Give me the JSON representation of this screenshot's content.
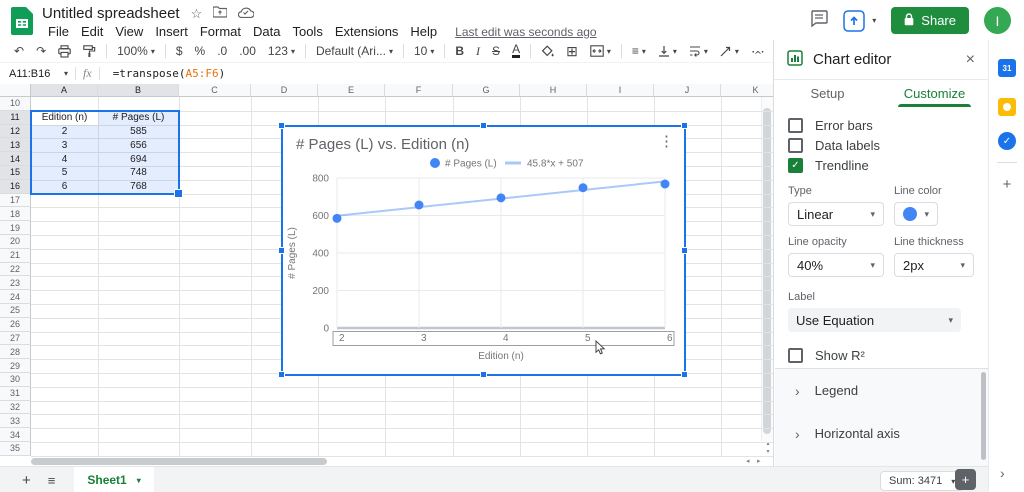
{
  "header": {
    "doc_title": "Untitled spreadsheet",
    "menu_items": [
      "File",
      "Edit",
      "View",
      "Insert",
      "Format",
      "Data",
      "Tools",
      "Extensions",
      "Help"
    ],
    "last_edit": "Last edit was seconds ago",
    "share_label": "Share",
    "avatar_letter": "I"
  },
  "toolbar": {
    "zoom_value": "100%",
    "currency": "$",
    "percent": "%",
    "decimal_decrease": ".0",
    "decimal_increase": ".00",
    "number_format": "123",
    "font_name": "Default (Ari...",
    "font_size": "10",
    "bold": "B",
    "italic": "I",
    "strikethrough": "S",
    "text_color": "A",
    "more": "⋯"
  },
  "formula_bar": {
    "name_box": "A11:B16",
    "fx_label": "fx",
    "formula_prefix": "=transpose(",
    "formula_range": "A5:F6",
    "formula_suffix": ")"
  },
  "grid": {
    "visible_columns": [
      "A",
      "B",
      "C",
      "D",
      "E",
      "F",
      "G",
      "H",
      "I",
      "J",
      "K"
    ],
    "first_visible_row": 10,
    "last_visible_row": 35,
    "selected_range": "A11:B16",
    "selected_columns": [
      "A",
      "B"
    ],
    "selected_rows": [
      11,
      12,
      13,
      14,
      15,
      16
    ],
    "table": {
      "origin_row": 11,
      "headers": [
        "Edition (n)",
        "# Pages (L)"
      ],
      "rows": [
        [
          "2",
          "585"
        ],
        [
          "3",
          "656"
        ],
        [
          "4",
          "694"
        ],
        [
          "5",
          "748"
        ],
        [
          "6",
          "768"
        ]
      ]
    }
  },
  "chart_data": {
    "type": "scatter",
    "title": "# Pages (L) vs. Edition (n)",
    "xlabel": "Edition (n)",
    "ylabel": "# Pages (L)",
    "x": [
      2,
      3,
      4,
      5,
      6
    ],
    "series": [
      {
        "name": "# Pages (L)",
        "values": [
          585,
          656,
          694,
          748,
          768
        ],
        "color": "#4285f4"
      }
    ],
    "trendline": {
      "label": "45.8*x + 507",
      "slope": 45.8,
      "intercept": 507,
      "color": "rgba(66,133,244,0.45)"
    },
    "x_ticks": [
      2,
      3,
      4,
      5,
      6
    ],
    "y_ticks": [
      0,
      200,
      400,
      600,
      800
    ],
    "xlim": [
      2,
      6
    ],
    "ylim": [
      0,
      800
    ],
    "grid": true,
    "legend_position": "top"
  },
  "chart_editor": {
    "title": "Chart editor",
    "tabs": [
      {
        "label": "Setup",
        "active": false
      },
      {
        "label": "Customize",
        "active": true
      }
    ],
    "checkboxes": [
      {
        "label": "Error bars",
        "checked": false
      },
      {
        "label": "Data labels",
        "checked": false
      },
      {
        "label": "Trendline",
        "checked": true
      }
    ],
    "type_label": "Type",
    "type_value": "Linear",
    "line_color_label": "Line color",
    "line_color_value": "#4285f4",
    "line_opacity_label": "Line opacity",
    "line_opacity_value": "40%",
    "line_thickness_label": "Line thickness",
    "line_thickness_value": "2px",
    "label_label": "Label",
    "label_value": "Use Equation",
    "show_r2": {
      "label": "Show R²",
      "checked": false
    },
    "sections": [
      "Legend",
      "Horizontal axis"
    ]
  },
  "bottom_bar": {
    "sheet_tab": "Sheet1",
    "sum_badge": "Sum: 3471"
  },
  "icons": {
    "star": "☆",
    "caret": "▾",
    "close": "×",
    "more_vert": "⋮",
    "chevron_right": "›",
    "check": "✓",
    "undo": "↶",
    "redo": "↷",
    "align": "≡",
    "borders": "⊞",
    "plus": "+",
    "hamburger": "≡",
    "scroll_left": "◂",
    "scroll_right": "▸",
    "scroll_up": "▴",
    "scroll_down": "▾"
  }
}
